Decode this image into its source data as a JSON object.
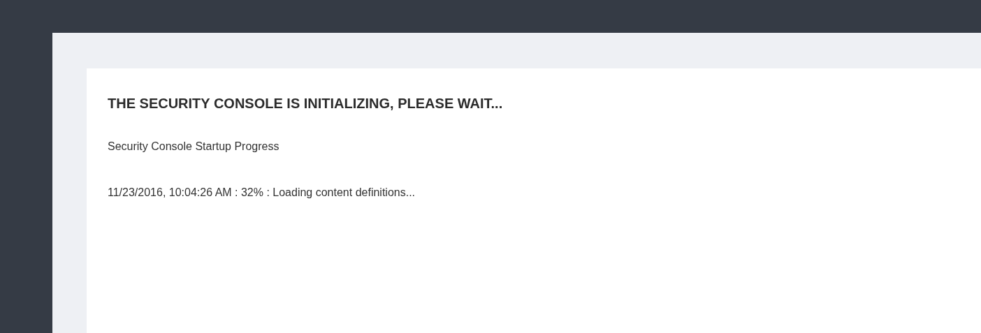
{
  "heading": "THE SECURITY CONSOLE IS INITIALIZING, PLEASE WAIT...",
  "subheading": "Security Console Startup Progress",
  "progress_log": [
    "11/23/2016, 10:04:26 AM : 32% : Loading content definitions..."
  ]
}
